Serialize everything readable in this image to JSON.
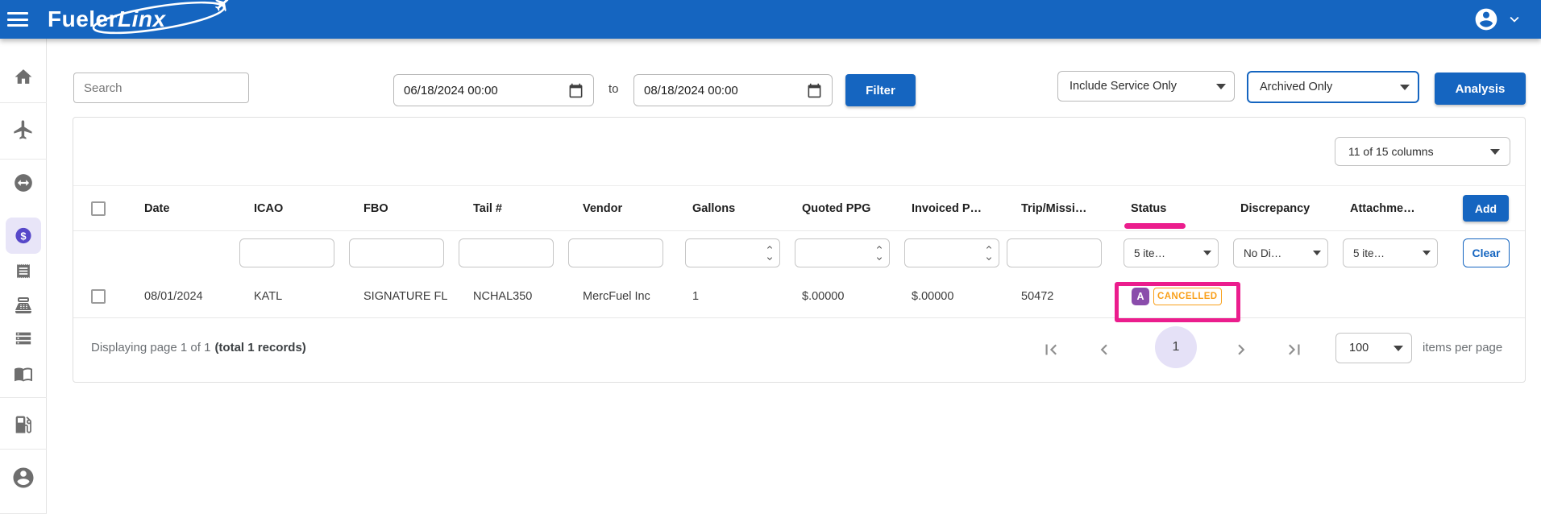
{
  "app": {
    "brand": {
      "part1": "Fueler",
      "part2": "Linx"
    },
    "colors": {
      "topbar_blue": "#1565C0",
      "accent_blue": "#1565C0",
      "annotation_pink": "#EB1D8D",
      "status_orange": "#F9A01B",
      "avatar_purple": "#8A4CAB",
      "active_sidebar_purple": "#5748C9",
      "active_sidebar_bg": "#E8E5F8",
      "page_circle_lavender": "#E5E1F7"
    }
  },
  "sidebar": {
    "items": [
      {
        "name": "home"
      },
      {
        "name": "flights"
      },
      {
        "name": "swap-transactions"
      },
      {
        "name": "fuel-purchases",
        "active": true
      },
      {
        "name": "receipts"
      },
      {
        "name": "point-of-sale"
      },
      {
        "name": "list"
      },
      {
        "name": "logbook"
      },
      {
        "name": "gas-station"
      },
      {
        "name": "account"
      }
    ]
  },
  "toolbar": {
    "search_placeholder": "Search",
    "date_from": "06/18/2024 00:00",
    "to_label": "to",
    "date_to": "08/18/2024 00:00",
    "filter_label": "Filter",
    "service_dropdown_value": "Include Service Only",
    "archived_dropdown_value": "Archived Only",
    "analysis_label": "Analysis"
  },
  "table": {
    "columns_dropdown_value": "11 of 15 columns",
    "headers": [
      "Date",
      "ICAO",
      "FBO",
      "Tail #",
      "Vendor",
      "Gallons",
      "Quoted PPG",
      "Invoiced P…",
      "Trip/Missi…",
      "Status",
      "Discrepancy",
      "Attachme…"
    ],
    "add_label": "Add",
    "filters": {
      "status_value": "5 ite…",
      "discrepancy_value": "No Di…",
      "attachments_value": "5 ite…",
      "clear_label": "Clear"
    },
    "row": {
      "date": "08/01/2024",
      "icao": "KATL",
      "fbo": "SIGNATURE FL",
      "tail": "NCHAL350",
      "vendor": "MercFuel Inc",
      "gallons": "1",
      "quoted_ppg": "$.00000",
      "invoiced_ppg": "$.00000",
      "trip": "50472",
      "status_avatar": "A",
      "status": "CANCELLED"
    }
  },
  "pagination": {
    "summary": "Displaying page 1 of 1",
    "summary_bold": "(total 1 records)",
    "current_page": "1",
    "page_size": "100",
    "items_per_page_label": "items per page"
  }
}
